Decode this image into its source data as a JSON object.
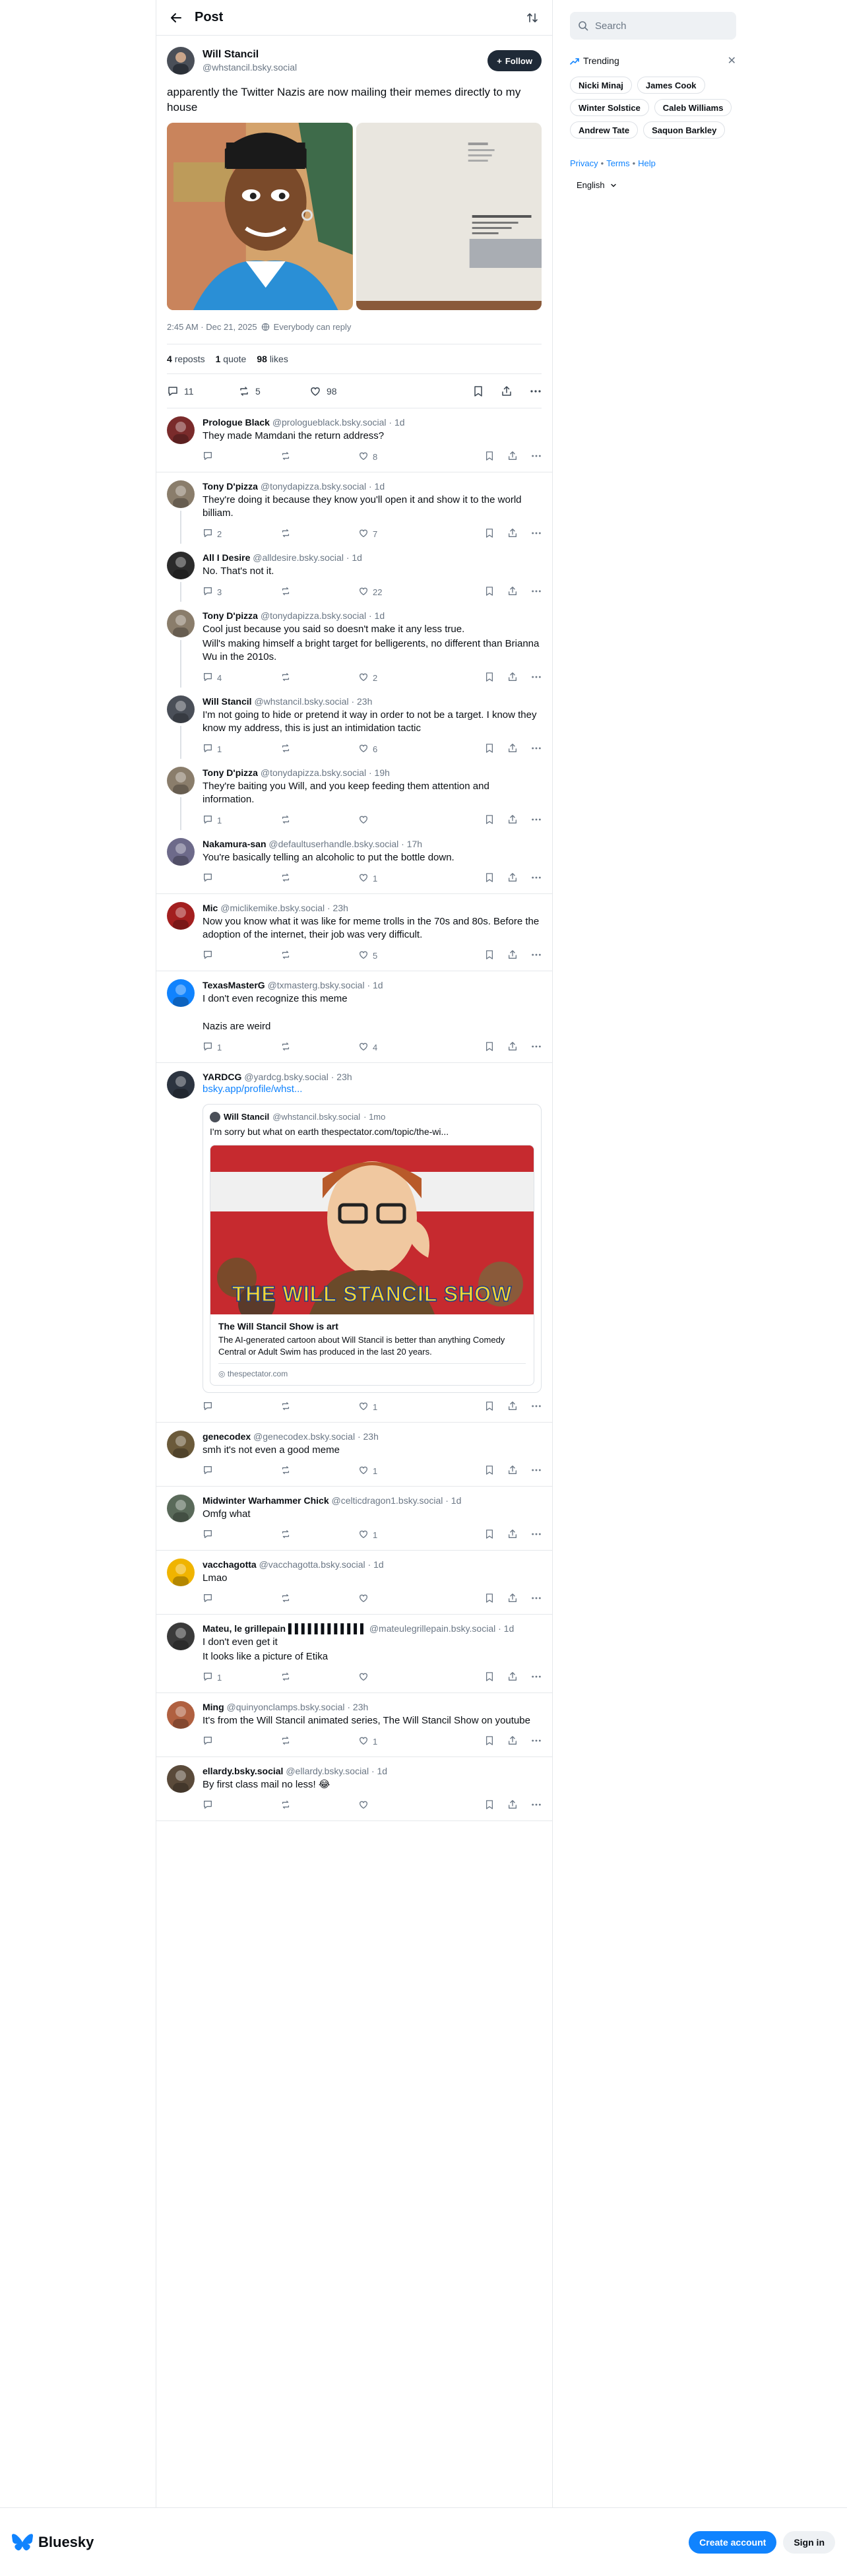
{
  "header": {
    "title": "Post"
  },
  "focused_post": {
    "display_name": "Will Stancil",
    "handle": "@whstancil.bsky.social",
    "follow_label": "Follow",
    "text": "apparently the Twitter Nazis are now mailing their memes directly to my house",
    "timestamp": "2:45 AM · Dec 21, 2025",
    "reply_setting": "Everybody can reply",
    "stats": {
      "reposts": "4",
      "reposts_label": "reposts",
      "quotes": "1",
      "quotes_label": "quote",
      "likes": "98",
      "likes_label": "likes"
    },
    "actions": {
      "replies": "11",
      "reposts": "5",
      "likes": "98"
    }
  },
  "replies": [
    {
      "name": "Prologue Black",
      "handle": "@prologueblack.bsky.social",
      "time": "· 1d",
      "text": "They made Mamdani the return address?",
      "replies": "",
      "likes": "8",
      "avatar_color": "#7a2b2b"
    },
    {
      "name": "Tony D'pizza",
      "handle": "@tonydapizza.bsky.social",
      "time": "· 1d",
      "text": "They're doing it because they know you'll open it and show it to the world billiam.",
      "replies": "2",
      "likes": "7",
      "avatar_color": "#8a7d6b"
    },
    {
      "name": "All I Desire",
      "handle": "@alldesire.bsky.social",
      "time": "· 1d",
      "text": "No. That's not it.",
      "replies": "3",
      "likes": "22",
      "avatar_color": "#2b2b2b"
    },
    {
      "name": "Tony D'pizza",
      "handle": "@tonydapizza.bsky.social",
      "time": "· 1d",
      "text": "Cool just because you said so doesn't make it any less true.",
      "text2": "Will's making himself a bright target for belligerents, no different than Brianna Wu in the 2010s.",
      "replies": "4",
      "likes": "2",
      "avatar_color": "#8a7d6b"
    },
    {
      "name": "Will Stancil",
      "handle": "@whstancil.bsky.social",
      "time": "· 23h",
      "text": "I'm not going to hide or pretend it way in order to not be a target. I know they know my address, this is just an intimidation tactic",
      "replies": "1",
      "likes": "6",
      "avatar_color": "#4a4f58"
    },
    {
      "name": "Tony D'pizza",
      "handle": "@tonydapizza.bsky.social",
      "time": "· 19h",
      "text": "They're baiting you Will, and you keep feeding them attention and information.",
      "replies": "1",
      "likes": "",
      "avatar_color": "#8a7d6b"
    },
    {
      "name": "Nakamura-san",
      "handle": "@defaultuserhandle.bsky.social",
      "time": "· 17h",
      "text": "You're basically telling an alcoholic to put the bottle down.",
      "replies": "",
      "likes": "1",
      "avatar_color": "#6d6a8a"
    },
    {
      "name": "Mic",
      "handle": "@miclikemike.bsky.social",
      "time": "· 23h",
      "text": "Now you know what it was like for meme trolls in the 70s and 80s. Before the adoption of the internet, their job was very difficult.",
      "replies": "",
      "likes": "5",
      "avatar_color": "#a31f1f"
    },
    {
      "name": "TexasMasterG",
      "handle": "@txmasterg.bsky.social",
      "time": "· 1d",
      "text": "I don't even recognize this meme",
      "text2": "Nazis are weird",
      "replies": "1",
      "likes": "4",
      "avatar_color": "#1083fe"
    },
    {
      "name": "YARDCG",
      "handle": "@yardcg.bsky.social",
      "time": "· 23h",
      "link": "bsky.app/profile/whst...",
      "replies": "",
      "likes": "1",
      "avatar_color": "#2c3440",
      "embed": {
        "name": "Will Stancil",
        "handle": "@whstancil.bsky.social",
        "time": "· 1mo",
        "text": "I'm sorry but what on earth thespectator.com/topic/the-wi...",
        "banner": "THE WILL STANCIL SHOW",
        "card_title": "The Will Stancil Show is art",
        "card_desc": "The AI-generated cartoon about Will Stancil is better than anything Comedy Central or Adult Swim has produced in the last 20 years.",
        "card_domain": "thespectator.com"
      }
    },
    {
      "name": "genecodex",
      "handle": "@genecodex.bsky.social",
      "time": "· 23h",
      "text": "smh it's not even a good meme",
      "replies": "",
      "likes": "1",
      "avatar_color": "#6b5a3a"
    },
    {
      "name": "Midwinter Warhammer Chick",
      "handle": "@celticdragon1.bsky.social",
      "time": "· 1d",
      "text": "Omfg what",
      "replies": "",
      "likes": "1",
      "avatar_color": "#5a6a5a"
    },
    {
      "name": "vacchagotta",
      "handle": "@vacchagotta.bsky.social",
      "time": "· 1d",
      "text": "Lmao",
      "replies": "",
      "likes": "",
      "avatar_color": "#f0b400"
    },
    {
      "name": "Mateu, le grillepain ▌▌▌▌▌▌▌▌▌▌▌▌",
      "handle": "@mateulegrillepain.bsky.social",
      "time": "· 1d",
      "text": "I don't even get it",
      "text2": "It looks like a picture of Etika",
      "replies": "1",
      "likes": "",
      "avatar_color": "#3a3a3a"
    },
    {
      "name": "Ming",
      "handle": "@quinyonclamps.bsky.social",
      "time": "· 23h",
      "text": "It's from the Will Stancil animated series, The Will Stancil Show on youtube",
      "replies": "",
      "likes": "1",
      "avatar_color": "#b06040"
    },
    {
      "name": "ellardy.bsky.social",
      "handle": "@ellardy.bsky.social",
      "time": "· 1d",
      "text": "By first class mail no less! 😂",
      "replies": "",
      "likes": "",
      "avatar_color": "#5a4a3a"
    }
  ],
  "sidebar": {
    "search_placeholder": "Search",
    "trending_label": "Trending",
    "trending": [
      "Nicki Minaj",
      "James Cook",
      "Winter Solstice",
      "Caleb Williams",
      "Andrew Tate",
      "Saquon Barkley"
    ],
    "links": [
      "Privacy",
      "Terms",
      "Help"
    ],
    "language": "English"
  },
  "bottom": {
    "brand": "Bluesky",
    "create": "Create account",
    "signin": "Sign in"
  },
  "colors": {
    "accent": "#1083fe",
    "border": "#e5e8eb",
    "muted": "#6b7785"
  }
}
